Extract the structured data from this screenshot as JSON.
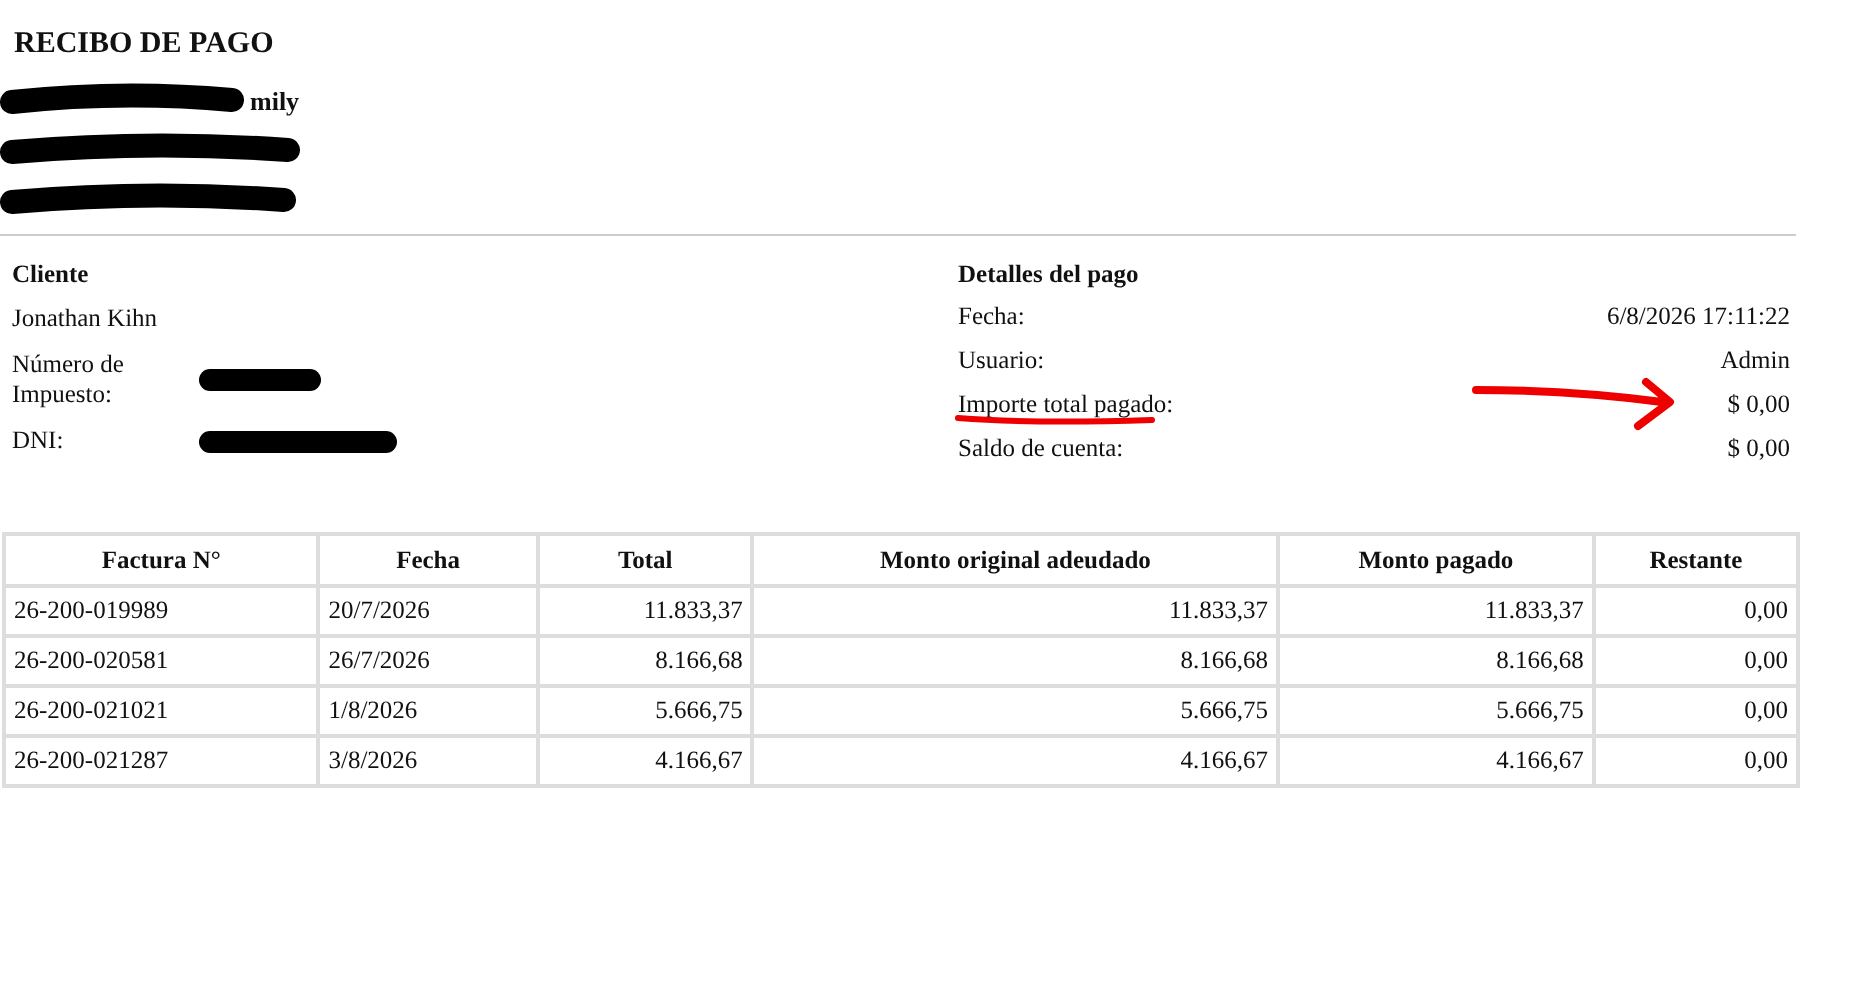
{
  "title": "RECIBO DE PAGO",
  "company": {
    "lines": [
      {
        "visible_text": "mily",
        "redacted": true
      },
      {
        "redacted": true
      },
      {
        "redacted": true
      }
    ]
  },
  "client": {
    "heading": "Cliente",
    "name": "Jonathan Kihn",
    "fields": [
      {
        "label": "Número de Impuesto:"
      },
      {
        "label": "DNI:"
      }
    ]
  },
  "payment": {
    "heading": "Detalles del pago",
    "rows": [
      {
        "label": "Fecha:",
        "value": "6/8/2026 17:11:22",
        "annotated": false
      },
      {
        "label": "Usuario:",
        "value": "Admin",
        "annotated": false
      },
      {
        "label": "Importe total pagado:",
        "value": "$ 0,00",
        "annotated": true
      },
      {
        "label": "Saldo de cuenta:",
        "value": "$ 0,00",
        "annotated": false
      }
    ]
  },
  "table": {
    "columns": [
      "Factura N°",
      "Fecha",
      "Total",
      "Monto original adeudado",
      "Monto pagado",
      "Restante"
    ],
    "rows": [
      [
        "26-200-019989",
        "20/7/2026",
        "11.833,37",
        "11.833,37",
        "11.833,37",
        "0,00"
      ],
      [
        "26-200-020581",
        "26/7/2026",
        "8.166,68",
        "8.166,68",
        "8.166,68",
        "0,00"
      ],
      [
        "26-200-021021",
        "1/8/2026",
        "5.666,75",
        "5.666,75",
        "5.666,75",
        "0,00"
      ],
      [
        "26-200-021287",
        "3/8/2026",
        "4.166,67",
        "4.166,67",
        "4.166,67",
        "0,00"
      ]
    ]
  }
}
